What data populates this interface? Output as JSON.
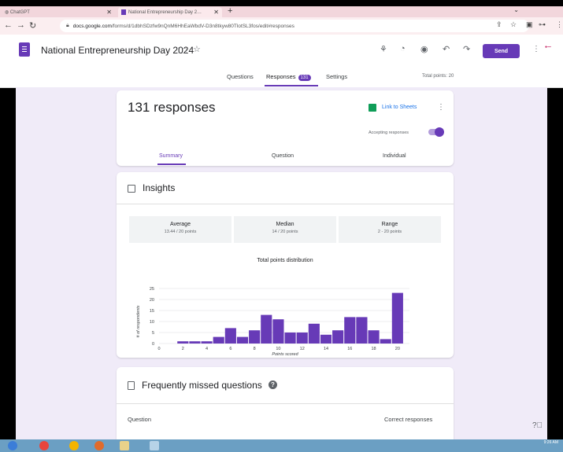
{
  "browser": {
    "tabs": [
      {
        "label": "ChatGPT"
      },
      {
        "label": "National Entrepreneurship Day 2…"
      }
    ],
    "url_host": "docs.google.com",
    "url_path": "/forms/d/1dbhSDzfw9nQnM6HhEaWbdV-D3n8tkyw80TlotSL3fos/edit#responses"
  },
  "form": {
    "title": "National Entrepreneurship Day 2024",
    "send_label": "Send",
    "tabs": {
      "questions": "Questions",
      "responses": "Responses",
      "responses_count": "131",
      "settings": "Settings"
    },
    "total_points": "Total points: 20"
  },
  "responses_card": {
    "count_label": "131 responses",
    "sheets_link": "Link to Sheets",
    "accepting": "Accepting responses",
    "subtabs": {
      "summary": "Summary",
      "question": "Question",
      "individual": "Individual"
    }
  },
  "insights": {
    "title": "Insights",
    "stats": [
      {
        "label": "Average",
        "value": "13.44 / 20 points"
      },
      {
        "label": "Median",
        "value": "14 / 20 points"
      },
      {
        "label": "Range",
        "value": "2 - 20 points"
      }
    ]
  },
  "chart_data": {
    "type": "bar",
    "title": "Total points distribution",
    "xlabel": "Points scored",
    "ylabel": "# of respondents",
    "x": [
      1,
      2,
      3,
      4,
      5,
      6,
      7,
      8,
      9,
      10,
      11,
      12,
      13,
      14,
      15,
      16,
      17,
      18,
      19,
      20
    ],
    "values": [
      0,
      1,
      1,
      1,
      3,
      7,
      3,
      6,
      13,
      11,
      5,
      5,
      9,
      4,
      6,
      12,
      12,
      6,
      2,
      23
    ],
    "xticks": [
      0,
      2,
      4,
      6,
      8,
      10,
      12,
      14,
      16,
      18,
      20
    ],
    "yticks": [
      0,
      5,
      10,
      15,
      20,
      25
    ],
    "xlim": [
      0,
      21
    ],
    "ylim": [
      0,
      25
    ],
    "bar_color": "#673ab7"
  },
  "missed": {
    "title": "Frequently missed questions",
    "col_question": "Question",
    "col_correct": "Correct responses"
  },
  "taskbar": {
    "time": "9:26 AM"
  },
  "colors": {
    "accent": "#673ab7",
    "background": "#f0ebf8"
  }
}
